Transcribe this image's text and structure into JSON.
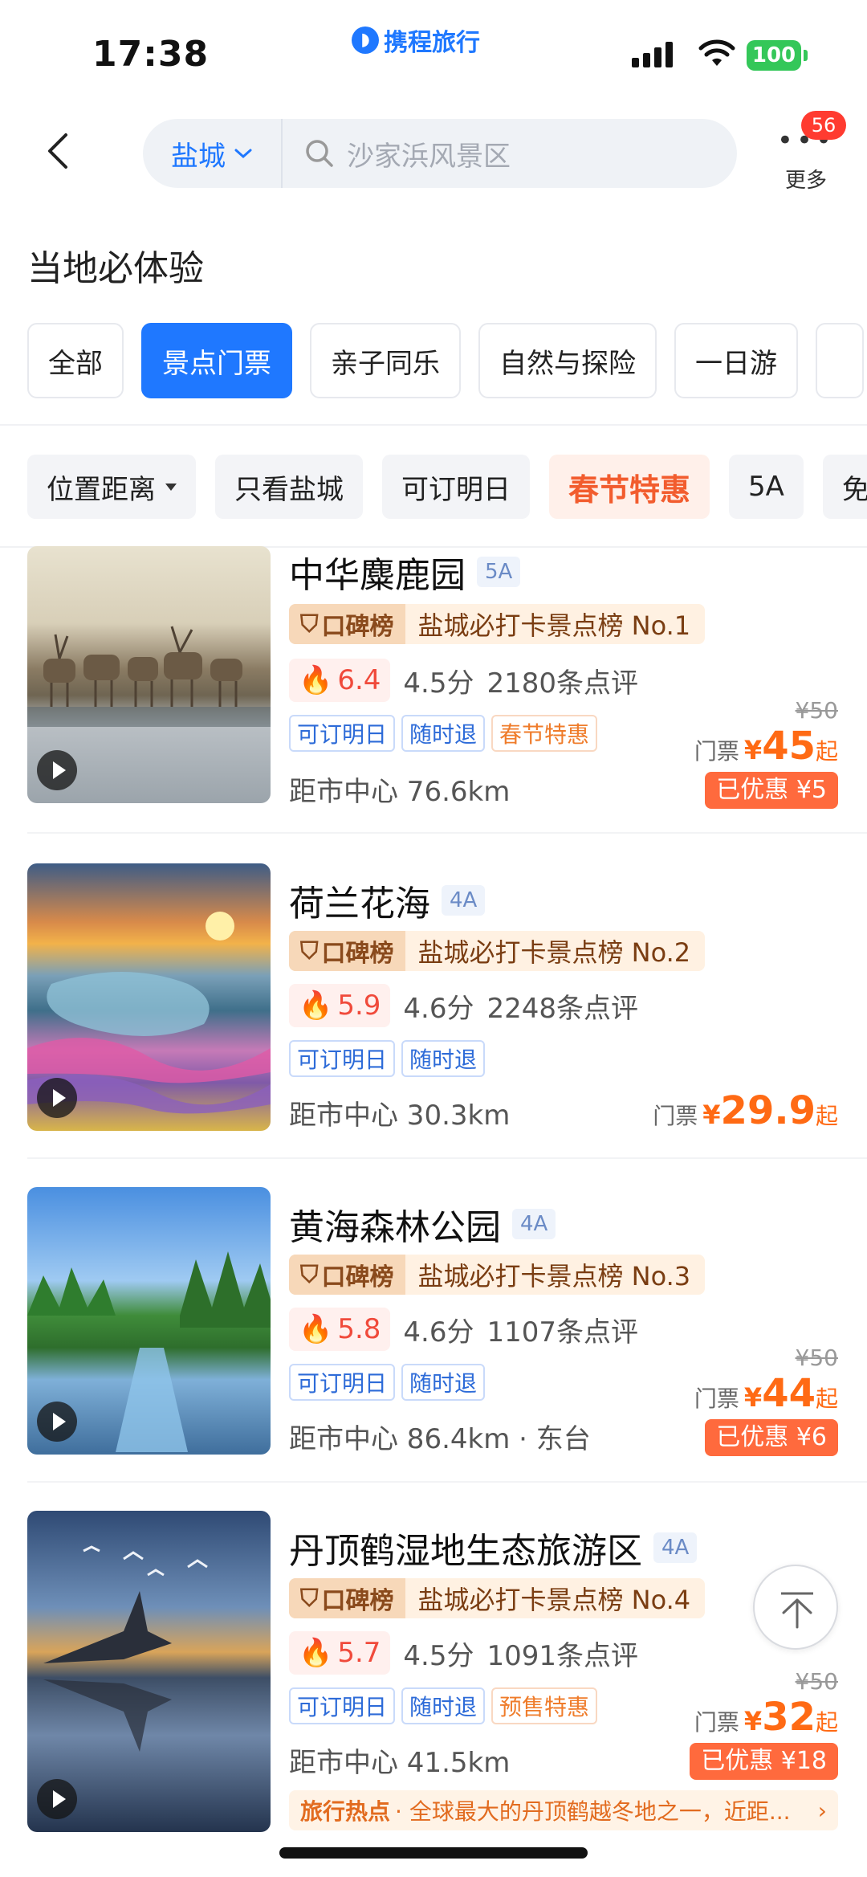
{
  "status_bar": {
    "time": "17:38",
    "app_logo": "携程旅行",
    "battery": "100"
  },
  "header": {
    "city": "盐城",
    "search_placeholder": "沙家浜风景区",
    "more_label": "更多",
    "more_badge": "56"
  },
  "section_title": "当地必体验",
  "category_tabs": [
    "全部",
    "景点门票",
    "亲子同乐",
    "自然与探险",
    "一日游"
  ],
  "active_tab": "景点门票",
  "filters": [
    "位置距离",
    "只看盐城",
    "可订明日",
    "春节特惠",
    "5A",
    "免"
  ],
  "cards": [
    {
      "name": "中华麋鹿园",
      "level": "5A",
      "rank_tag": "口碑榜",
      "rank_text": "盐城必打卡景点榜 No.1",
      "heat": "6.4",
      "rating": "4.5分",
      "reviews": "2180条点评",
      "tags": [
        "可订明日",
        "随时退",
        "春节特惠"
      ],
      "distance": "距市中心 76.6km",
      "orig_price": "¥50",
      "price_label": "门票",
      "yen": "¥",
      "price": "45",
      "price_suffix": "起",
      "saving": "已优惠 ¥5"
    },
    {
      "name": "荷兰花海",
      "level": "4A",
      "rank_tag": "口碑榜",
      "rank_text": "盐城必打卡景点榜 No.2",
      "heat": "5.9",
      "rating": "4.6分",
      "reviews": "2248条点评",
      "tags": [
        "可订明日",
        "随时退"
      ],
      "distance": "距市中心 30.3km",
      "price_label": "门票",
      "yen": "¥",
      "price": "29.9",
      "price_suffix": "起"
    },
    {
      "name": "黄海森林公园",
      "level": "4A",
      "rank_tag": "口碑榜",
      "rank_text": "盐城必打卡景点榜 No.3",
      "heat": "5.8",
      "rating": "4.6分",
      "reviews": "1107条点评",
      "tags": [
        "可订明日",
        "随时退"
      ],
      "distance": "距市中心 86.4km · 东台",
      "orig_price": "¥50",
      "price_label": "门票",
      "yen": "¥",
      "price": "44",
      "price_suffix": "起",
      "saving": "已优惠 ¥6"
    },
    {
      "name": "丹顶鹤湿地生态旅游区",
      "level": "4A",
      "rank_tag": "口碑榜",
      "rank_text": "盐城必打卡景点榜 No.4",
      "heat": "5.7",
      "rating": "4.5分",
      "reviews": "1091条点评",
      "tags": [
        "可订明日",
        "随时退",
        "预售特惠"
      ],
      "distance": "距市中心 41.5km",
      "orig_price": "¥50",
      "price_label": "门票",
      "yen": "¥",
      "price": "32",
      "price_suffix": "起",
      "saving": "已优惠 ¥18",
      "hot_title": "旅行热点",
      "hot_text": "· 全球最大的丹顶鹤越冬地之一，近距..."
    }
  ]
}
